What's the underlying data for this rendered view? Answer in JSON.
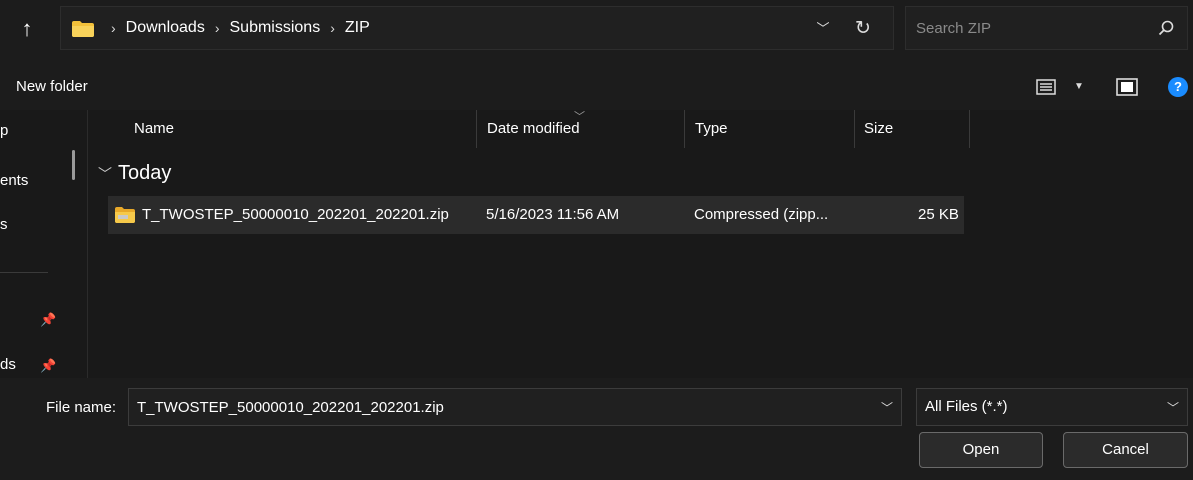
{
  "address": {
    "breadcrumbs": [
      "Downloads",
      "Submissions",
      "ZIP"
    ],
    "separator": "›"
  },
  "search": {
    "placeholder": "Search ZIP"
  },
  "toolbar": {
    "new_folder_label": "New folder",
    "help_label": "?"
  },
  "nav": {
    "items": [
      {
        "label": "p"
      },
      {
        "label": "ents"
      },
      {
        "label": "s"
      },
      {
        "label": "ds"
      }
    ]
  },
  "list": {
    "columns": [
      "Name",
      "Date modified",
      "Type",
      "Size"
    ],
    "groups": [
      {
        "label": "Today",
        "files": [
          {
            "name": "T_TWOSTEP_50000010_202201_202201.zip",
            "date_modified": "5/16/2023 11:56 AM",
            "type": "Compressed (zipp...",
            "size": "25 KB"
          }
        ]
      }
    ]
  },
  "bottom": {
    "file_name_label": "File name:",
    "file_name_value": "T_TWOSTEP_50000010_202201_202201.zip",
    "filter_value": "All Files (*.*)",
    "open_label": "Open",
    "cancel_label": "Cancel"
  },
  "icons": {
    "up": "up-arrow-icon",
    "folder": "folder-icon",
    "refresh": "refresh-icon",
    "search": "search-icon",
    "view": "details-view-icon",
    "preview": "preview-pane-icon",
    "help": "help-icon",
    "pin": "pin-icon",
    "zip": "zip-folder-icon"
  },
  "colors": {
    "background": "#191919",
    "row_selected": "#2b2b2b",
    "folder_yellow": "#f3c13a",
    "help_blue": "#1a8cff"
  }
}
